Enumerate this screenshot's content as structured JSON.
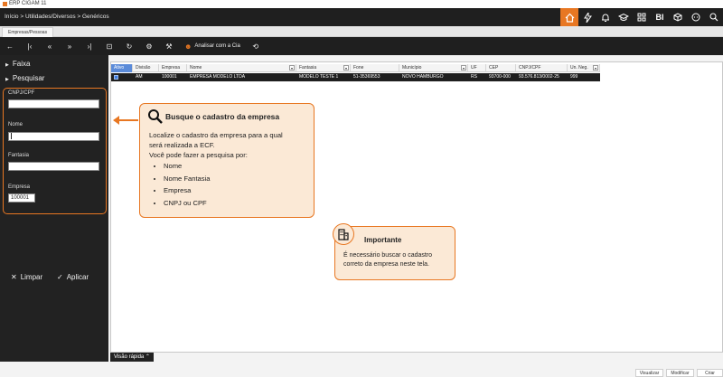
{
  "window": {
    "title": "ERP CIGAM 11"
  },
  "topbar": {
    "breadcrumb": "Início > Utilidades/Diversos > Genéricos",
    "icons": [
      "home-icon",
      "lightning-icon",
      "bell-icon",
      "graduation-icon",
      "grid-icon",
      "bi-icon",
      "box-icon",
      "chat-icon",
      "search-icon"
    ],
    "bi_label": "BI"
  },
  "tabstrip": {
    "active_tab": "Empresas/Pessoas"
  },
  "toolbar": {
    "analisar_label": "Analisar com a Cia"
  },
  "sidebar": {
    "faixa": "Faixa",
    "pesquisar": "Pesquisar",
    "fields": {
      "cnpj_label": "CNPJ/CPF",
      "cnpj_value": "",
      "nome_label": "Nome",
      "nome_value": "",
      "fantasia_label": "Fantasia",
      "fantasia_value": "",
      "empresa_label": "Empresa",
      "empresa_value": "100001"
    },
    "limpar": "Limpar",
    "aplicar": "Aplicar"
  },
  "table": {
    "headers": [
      "Ativo",
      "Divisão",
      "Empresa",
      "Nome",
      "Fantasia",
      "Fone",
      "Município",
      "UF",
      "CEP",
      "CNPJ/CPF",
      "Un. Neg."
    ],
    "rows": [
      {
        "divisao": "AM",
        "empresa": "100001",
        "nome": "EMPRESA MODELO LTDA",
        "fantasia": "MODELO TESTE 1",
        "fone": "51-35369553",
        "municipio": "NOVO HAMBURGO",
        "uf": "RS",
        "cep": "93700-000",
        "cnpj": "93.576.813/0002-25",
        "un_neg": "999"
      }
    ]
  },
  "callout": {
    "title": "Busque o cadastro da empresa",
    "line1": "Localize o cadastro da empresa para a qual",
    "line2": "será realizada a ECF.",
    "line3": "Você pode fazer a pesquisa por:",
    "items": [
      "Nome",
      "Nome Fantasia",
      "Empresa",
      "CNPJ ou CPF"
    ]
  },
  "important": {
    "title": "Importante",
    "line1": "É necessário buscar o cadastro",
    "line2": "correto da empresa neste tela."
  },
  "footer": {
    "visao_rapida": "Visão rápida",
    "visualizar": "Visualizar",
    "modificar": "Modificar",
    "criar": "Criar"
  },
  "colors": {
    "accent": "#e87722",
    "dark": "#1f1f1f",
    "callout_bg": "#fbe9d6"
  }
}
